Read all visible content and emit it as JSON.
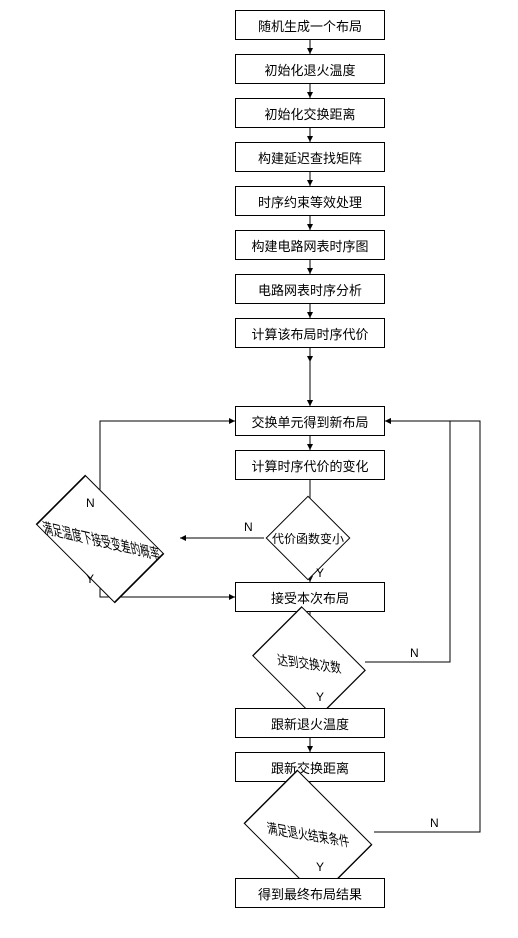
{
  "flow": {
    "steps": {
      "s1": "随机生成一个布局",
      "s2": "初始化退火温度",
      "s3": "初始化交换距离",
      "s4": "构建延迟查找矩阵",
      "s5": "时序约束等效处理",
      "s6": "构建电路网表时序图",
      "s7": "电路网表时序分析",
      "s8": "计算该布局时序代价",
      "s9": "交换单元得到新布局",
      "s10": "计算时序代价的变化",
      "s11": "接受本次布局",
      "s12": "跟新退火温度",
      "s13": "跟新交换距离",
      "s14": "得到最终布局结果"
    },
    "decisions": {
      "d1": "满足温度下接受变差的概率",
      "d2": "代价函数变小",
      "d3": "达到交换次数",
      "d4": "满足退火结束条件"
    },
    "branches": {
      "yes": "Y",
      "no": "N"
    }
  },
  "chart_data": {
    "type": "flowchart",
    "nodes": [
      {
        "id": "s1",
        "type": "process",
        "label": "随机生成一个布局"
      },
      {
        "id": "s2",
        "type": "process",
        "label": "初始化退火温度"
      },
      {
        "id": "s3",
        "type": "process",
        "label": "初始化交换距离"
      },
      {
        "id": "s4",
        "type": "process",
        "label": "构建延迟查找矩阵"
      },
      {
        "id": "s5",
        "type": "process",
        "label": "时序约束等效处理"
      },
      {
        "id": "s6",
        "type": "process",
        "label": "构建电路网表时序图"
      },
      {
        "id": "s7",
        "type": "process",
        "label": "电路网表时序分析"
      },
      {
        "id": "s8",
        "type": "process",
        "label": "计算该布局时序代价"
      },
      {
        "id": "s9",
        "type": "process",
        "label": "交换单元得到新布局"
      },
      {
        "id": "s10",
        "type": "process",
        "label": "计算时序代价的变化"
      },
      {
        "id": "d2",
        "type": "decision",
        "label": "代价函数变小"
      },
      {
        "id": "d1",
        "type": "decision",
        "label": "满足温度下接受变差的概率"
      },
      {
        "id": "s11",
        "type": "process",
        "label": "接受本次布局"
      },
      {
        "id": "d3",
        "type": "decision",
        "label": "达到交换次数"
      },
      {
        "id": "s12",
        "type": "process",
        "label": "跟新退火温度"
      },
      {
        "id": "s13",
        "type": "process",
        "label": "跟新交换距离"
      },
      {
        "id": "d4",
        "type": "decision",
        "label": "满足退火结束条件"
      },
      {
        "id": "s14",
        "type": "process",
        "label": "得到最终布局结果"
      }
    ],
    "edges": [
      {
        "from": "s1",
        "to": "s2"
      },
      {
        "from": "s2",
        "to": "s3"
      },
      {
        "from": "s3",
        "to": "s4"
      },
      {
        "from": "s4",
        "to": "s5"
      },
      {
        "from": "s5",
        "to": "s6"
      },
      {
        "from": "s6",
        "to": "s7"
      },
      {
        "from": "s7",
        "to": "s8"
      },
      {
        "from": "s8",
        "to": "s9"
      },
      {
        "from": "s9",
        "to": "s10"
      },
      {
        "from": "s10",
        "to": "d2"
      },
      {
        "from": "d2",
        "to": "s11",
        "label": "Y"
      },
      {
        "from": "d2",
        "to": "d1",
        "label": "N"
      },
      {
        "from": "d1",
        "to": "s11",
        "label": "Y"
      },
      {
        "from": "d1",
        "to": "s9",
        "label": "N"
      },
      {
        "from": "s11",
        "to": "d3"
      },
      {
        "from": "d3",
        "to": "s12",
        "label": "Y"
      },
      {
        "from": "d3",
        "to": "s9",
        "label": "N"
      },
      {
        "from": "s12",
        "to": "s13"
      },
      {
        "from": "s13",
        "to": "d4"
      },
      {
        "from": "d4",
        "to": "s14",
        "label": "Y"
      },
      {
        "from": "d4",
        "to": "s9",
        "label": "N"
      }
    ]
  }
}
